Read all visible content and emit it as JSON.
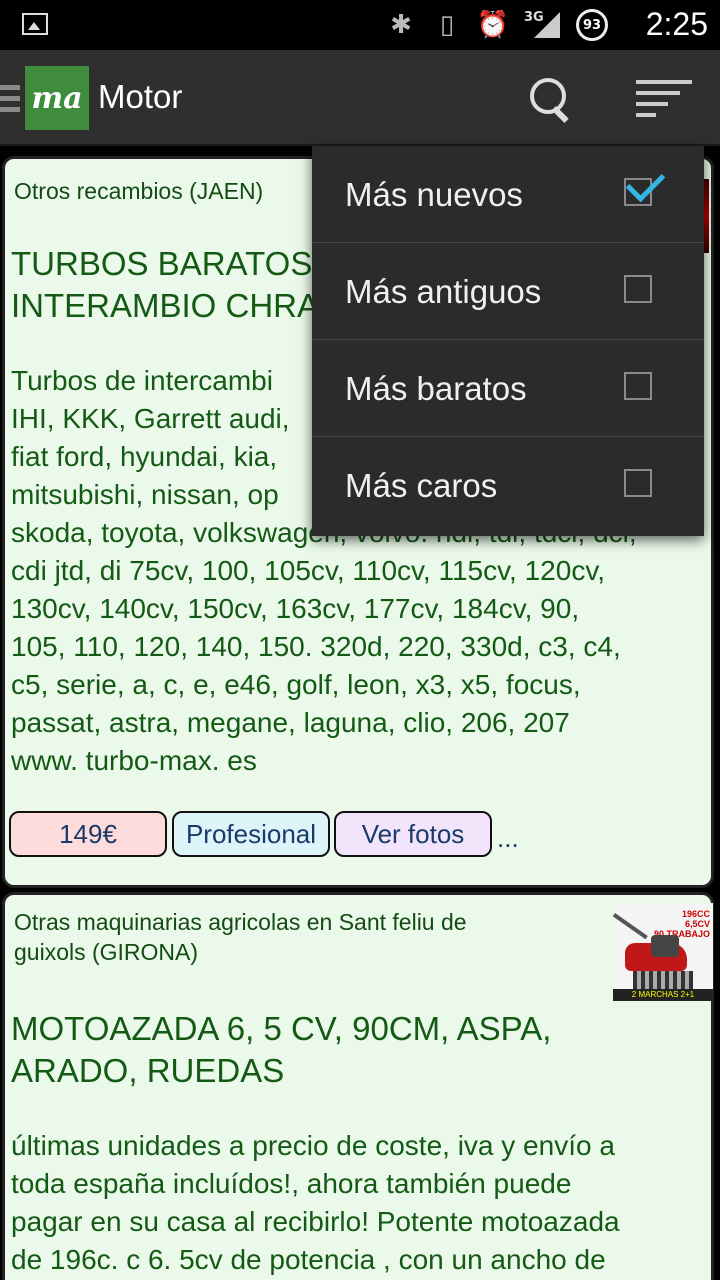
{
  "status_bar": {
    "time": "2:25",
    "network": "3G",
    "battery": "93"
  },
  "action_bar": {
    "logo": "ma",
    "title": "Motor"
  },
  "sort_menu": {
    "items": [
      {
        "label": "Más nuevos",
        "checked": true
      },
      {
        "label": "Más antiguos",
        "checked": false
      },
      {
        "label": "Más baratos",
        "checked": false
      },
      {
        "label": "Más caros",
        "checked": false
      }
    ]
  },
  "listings": [
    {
      "category": "Otros recambios (JAEN)",
      "title_line1": "TURBOS BARATOS",
      "title_line2": "INTERAMBIO CHRA",
      "desc_lines": [
        "Turbos de intercambi",
        "IHI, KKK, Garrett audi,",
        "fiat ford, hyundai, kia,",
        "mitsubishi, nissan, op",
        "skoda, toyota, volkswagen, volvo. hdi, tdi, tdci, dci,",
        "cdi jtd, di 75cv, 100, 105cv, 110cv, 115cv, 120cv,",
        "130cv, 140cv, 150cv, 163cv, 177cv, 184cv, 90,",
        "105, 110, 120, 140, 150. 320d, 220, 330d, c3, c4,",
        "c5, serie, a, c, e, e46, golf, leon, x3, x5, focus,",
        "passat, astra, megane, laguna, clio, 206, 207",
        "www. turbo-max. es"
      ],
      "price": "149€",
      "seller_type": "Profesional",
      "photos_label": "Ver fotos",
      "more": "..."
    },
    {
      "category_line1": "Otras maquinarias agricolas en Sant feliu de",
      "category_line2": "guixols (GIRONA)",
      "title_line1": "MOTOAZADA 6, 5 CV, 90CM, ASPA,",
      "title_line2": "ARADO, RUEDAS",
      "desc_lines": [
        "últimas unidades a precio de coste, iva y envío a",
        "toda españa incluídos!, ahora también puede",
        "pagar en su casa al recibirlo! Potente motoazada",
        "de 196c. c 6. 5cv de potencia , con un ancho de"
      ],
      "thumb_text_1": "196CC",
      "thumb_text_2": "6,5CV",
      "thumb_text_3": "90 TRABAJO",
      "thumb_footer": "2 MARCHAS 2+1"
    }
  ]
}
